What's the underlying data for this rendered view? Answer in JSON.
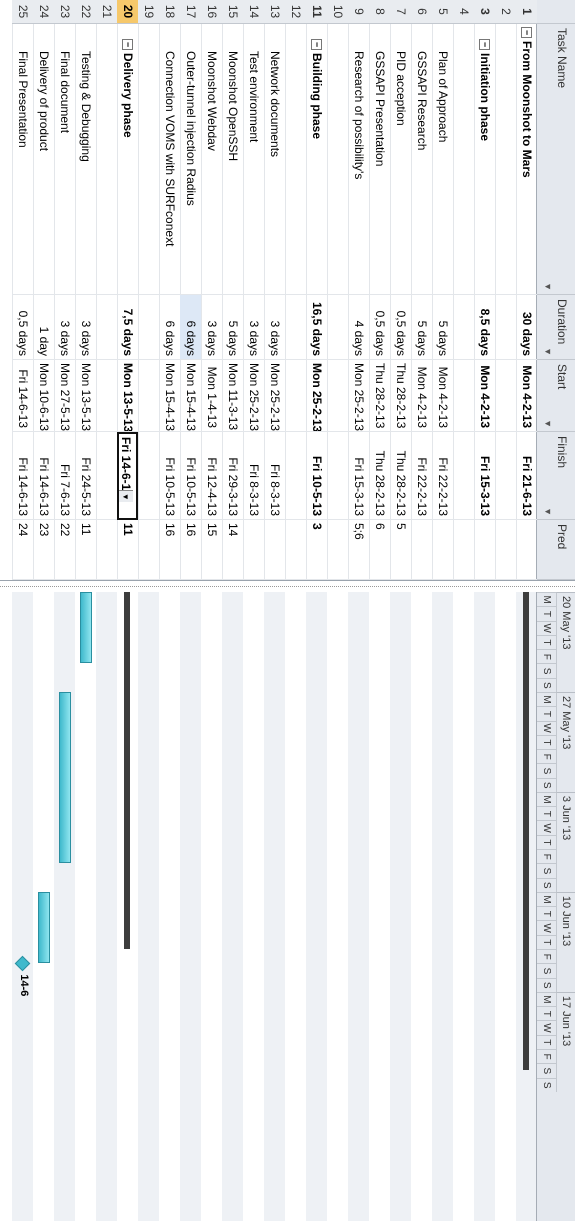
{
  "columns": {
    "name": "Task Name",
    "duration": "Duration",
    "start": "Start",
    "finish": "Finish",
    "pred": "Pred"
  },
  "rows": [
    {
      "id": "1",
      "name": "From Moonshot to Mars",
      "dur": "30 days",
      "start": "Mon 4-2-13",
      "fin": "Fri 21-6-13",
      "pred": "",
      "bold": true,
      "level": 0,
      "toggle": "−"
    },
    {
      "id": "2",
      "name": "",
      "dur": "",
      "start": "",
      "fin": "",
      "pred": ""
    },
    {
      "id": "3",
      "name": "Initiation phase",
      "dur": "8,5 days",
      "start": "Mon 4-2-13",
      "fin": "Fri 15-3-13",
      "pred": "",
      "bold": true,
      "level": 1,
      "toggle": "−"
    },
    {
      "id": "4",
      "name": "",
      "dur": "",
      "start": "",
      "fin": "",
      "pred": ""
    },
    {
      "id": "5",
      "name": "Plan of Approach",
      "dur": "5 days",
      "start": "Mon 4-2-13",
      "fin": "Fri 22-2-13",
      "pred": "",
      "level": 2
    },
    {
      "id": "6",
      "name": "GSSAPI Research",
      "dur": "5 days",
      "start": "Mon 4-2-13",
      "fin": "Fri 22-2-13",
      "pred": "",
      "level": 2
    },
    {
      "id": "7",
      "name": "PID acception",
      "dur": "0,5 days",
      "start": "Thu 28-2-13",
      "fin": "Thu 28-2-13",
      "pred": "5",
      "level": 2
    },
    {
      "id": "8",
      "name": "GSSAPI Presentation",
      "dur": "0,5 days",
      "start": "Thu 28-2-13",
      "fin": "Thu 28-2-13",
      "pred": "6",
      "level": 2
    },
    {
      "id": "9",
      "name": "Research of possibility's",
      "dur": "4 days",
      "start": "Mon 25-2-13",
      "fin": "Fri 15-3-13",
      "pred": "5;6",
      "level": 2
    },
    {
      "id": "10",
      "name": "",
      "dur": "",
      "start": "",
      "fin": "",
      "pred": ""
    },
    {
      "id": "11",
      "name": "Building phase",
      "dur": "16,5 days",
      "start": "Mon 25-2-13",
      "fin": "Fri 10-5-13",
      "pred": "3",
      "bold": true,
      "level": 1,
      "toggle": "−"
    },
    {
      "id": "12",
      "name": "",
      "dur": "",
      "start": "",
      "fin": "",
      "pred": ""
    },
    {
      "id": "13",
      "name": "Network documents",
      "dur": "3 days",
      "start": "Mon 25-2-13",
      "fin": "Fri 8-3-13",
      "pred": "",
      "level": 2
    },
    {
      "id": "14",
      "name": "Test environment",
      "dur": "3 days",
      "start": "Mon 25-2-13",
      "fin": "Fri 8-3-13",
      "pred": "",
      "level": 2
    },
    {
      "id": "15",
      "name": "Moonshot OpenSSH",
      "dur": "5 days",
      "start": "Mon 11-3-13",
      "fin": "Fri 29-3-13",
      "pred": "14",
      "level": 2
    },
    {
      "id": "16",
      "name": "Moonshot Webdav",
      "dur": "3 days",
      "start": "Mon 1-4-13",
      "fin": "Fri 12-4-13",
      "pred": "15",
      "level": 2
    },
    {
      "id": "17",
      "name": "Outer-tunnel injection Radius",
      "dur": "6 days",
      "start": "Mon 15-4-13",
      "fin": "Fri 10-5-13",
      "pred": "16",
      "level": 2
    },
    {
      "id": "18",
      "name": "Connection VOMS with SURFconext",
      "dur": "6 days",
      "start": "Mon 15-4-13",
      "fin": "Fri 10-5-13",
      "pred": "16",
      "level": 2
    },
    {
      "id": "19",
      "name": "",
      "dur": "",
      "start": "",
      "fin": "",
      "pred": ""
    },
    {
      "id": "20",
      "name": "Delivery phase",
      "dur": "7,5 days",
      "start": "Mon 13-5-13",
      "fin": "Fri 14-6-1",
      "pred": "11",
      "bold": true,
      "level": 1,
      "toggle": "−",
      "selected": true
    },
    {
      "id": "21",
      "name": "",
      "dur": "",
      "start": "",
      "fin": "",
      "pred": ""
    },
    {
      "id": "22",
      "name": "Testing & Debugging",
      "dur": "3 days",
      "start": "Mon 13-5-13",
      "fin": "Fri 24-5-13",
      "pred": "11",
      "level": 2
    },
    {
      "id": "23",
      "name": "Final document",
      "dur": "3 days",
      "start": "Mon 27-5-13",
      "fin": "Fri 7-6-13",
      "pred": "22",
      "level": 2
    },
    {
      "id": "24",
      "name": "Delivery of product",
      "dur": "1 day",
      "start": "Mon 10-6-13",
      "fin": "Fri 14-6-13",
      "pred": "23",
      "level": 2
    },
    {
      "id": "25",
      "name": "Final Presentation",
      "dur": "0,5 days",
      "start": "Fri 14-6-13",
      "fin": "Fri 14-6-13",
      "pred": "24",
      "level": 2
    }
  ],
  "timescale": {
    "weeks": [
      "20 May '13",
      "27 May '13",
      "3 Jun '13",
      "10 Jun '13",
      "17 Jun '13"
    ],
    "days": [
      "M",
      "T",
      "W",
      "T",
      "F",
      "S",
      "S"
    ]
  },
  "milestone_label": "14-6",
  "colors": {
    "header_bg": "#e4e8ee",
    "selected_id": "#f6c86b",
    "task_bar": "#3fb9cc",
    "summary_bar": "#3d3d3d",
    "stripe": "#eef1f5"
  }
}
